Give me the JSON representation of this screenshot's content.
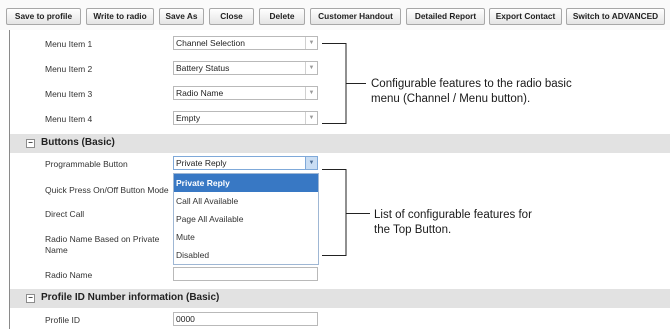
{
  "toolbar": {
    "buttons": [
      {
        "name": "save-to-profile-button",
        "label": "Save to profile"
      },
      {
        "name": "write-to-radio-button",
        "label": "Write to radio"
      },
      {
        "name": "save-as-button",
        "label": "Save As"
      },
      {
        "name": "close-button",
        "label": "Close"
      },
      {
        "name": "delete-button",
        "label": "Delete"
      },
      {
        "name": "customer-handout-button",
        "label": "Customer Handout"
      },
      {
        "name": "detailed-report-button",
        "label": "Detailed Report"
      },
      {
        "name": "export-contact-button",
        "label": "Export Contact"
      },
      {
        "name": "switch-to-advanced-button",
        "label": "Switch to ADVANCED"
      }
    ]
  },
  "menu": {
    "items": [
      {
        "label": "Menu Item 1",
        "value": "Channel Selection"
      },
      {
        "label": "Menu Item 2",
        "value": "Battery Status"
      },
      {
        "label": "Menu Item 3",
        "value": "Radio Name"
      },
      {
        "label": "Menu Item 4",
        "value": "Empty"
      }
    ]
  },
  "buttons_section": {
    "title": "Buttons (Basic)",
    "toggle": "−",
    "programmable_button": {
      "label": "Programmable Button",
      "value": "Private Reply"
    },
    "quick_press": {
      "label": "Quick Press On/Off Button Mode"
    },
    "direct_call": {
      "label": "Direct Call"
    },
    "radio_name_based": {
      "label": "Radio Name Based on Private Name"
    },
    "radio_name": {
      "label": "Radio Name",
      "value": ""
    },
    "dropdown_options": [
      "Private Reply",
      "Call All Available",
      "Page All Available",
      "Mute",
      "Disabled"
    ],
    "selected_option": "Private Reply"
  },
  "profile_section": {
    "title": "Profile ID Number information (Basic)",
    "toggle": "−",
    "profile_id": {
      "label": "Profile ID",
      "value": "0000"
    }
  },
  "callouts": {
    "menu_line1": "Configurable features to the radio basic",
    "menu_line2": "menu (Channel / Menu button).",
    "top_button_line1": "List of configurable features for",
    "top_button_line2": "the Top Button."
  },
  "icons": {
    "dropdown_arrow": "▼"
  }
}
